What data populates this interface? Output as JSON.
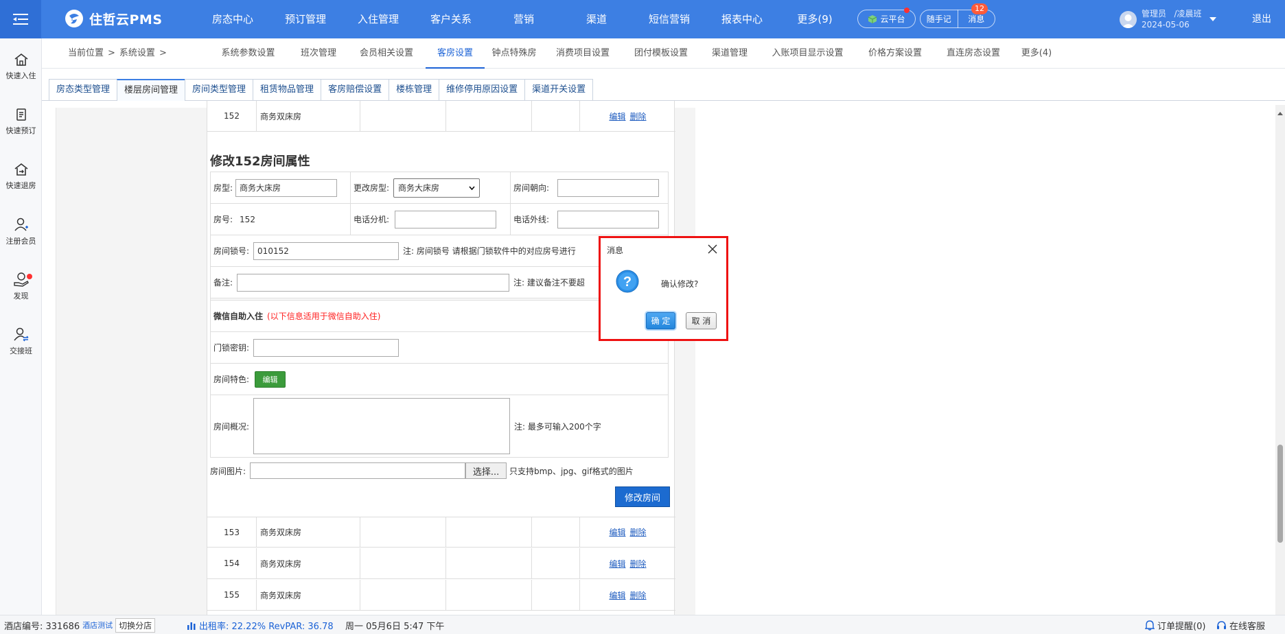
{
  "app": {
    "brand": "住哲云PMS"
  },
  "nav": [
    "房态中心",
    "预订管理",
    "入住管理",
    "客户关系",
    "营销",
    "渠道",
    "短信营销",
    "报表中心",
    "更多(9)"
  ],
  "top": {
    "cloud": "云平台",
    "notes": "随手记",
    "messages": "消息",
    "message_count": "12",
    "user_role": "管理员",
    "user_shift": "/凌晨班",
    "date": "2024-05-06",
    "logout": "退出"
  },
  "sidebar": [
    "快速入住",
    "快速预订",
    "快速退房",
    "注册会员",
    "发现",
    "交接班"
  ],
  "breadcrumb": {
    "here": "当前位置",
    "sep": ">",
    "section": "系统设置",
    "sep2": ">"
  },
  "subtabs": [
    "系统参数设置",
    "班次管理",
    "会员相关设置",
    "客房设置",
    "钟点特殊房",
    "消费项目设置",
    "团付模板设置",
    "渠道管理",
    "入账项目显示设置",
    "价格方案设置",
    "直连房态设置",
    "更多(4)"
  ],
  "tabs": [
    "房态类型管理",
    "楼层房间管理",
    "房间类型管理",
    "租赁物品管理",
    "客房赔偿设置",
    "楼栋管理",
    "维修停用原因设置",
    "渠道开关设置"
  ],
  "rows_top": [
    {
      "no": "152",
      "type": "商务双床房",
      "edit": "编辑",
      "del": "删除"
    }
  ],
  "rows_bottom": [
    {
      "no": "153",
      "type": "商务双床房",
      "edit": "编辑",
      "del": "删除"
    },
    {
      "no": "154",
      "type": "商务双床房",
      "edit": "编辑",
      "del": "删除"
    },
    {
      "no": "155",
      "type": "商务双床房",
      "edit": "编辑",
      "del": "删除"
    }
  ],
  "form": {
    "title": "修改152房间属性",
    "room_type_label": "房型:",
    "room_type_value": "商务大床房",
    "change_type_label": "更改房型:",
    "change_type_value": "商务大床房",
    "orientation_label": "房间朝向:",
    "room_no_label": "房号:",
    "room_no_value": "152",
    "ext_label": "电话分机:",
    "outline_label": "电话外线:",
    "lock_label": "房间锁号:",
    "lock_value": "010152",
    "lock_note": "注: 房间锁号 请根据门锁软件中的对应房号进行",
    "remark_label": "备注:",
    "remark_note": "注: 建议备注不要超",
    "wechat_title": "微信自助入住",
    "wechat_note": "(以下信息适用于微信自助入住)",
    "lock_key_label": "门锁密钥:",
    "feature_label": "房间特色:",
    "feature_btn": "编辑",
    "overview_label": "房间概况:",
    "overview_note": "注: 最多可输入200个字",
    "image_label": "房间图片:",
    "choose_btn": "选择...",
    "image_note": "只支持bmp、jpg、gif格式的图片",
    "submit": "修改房间"
  },
  "dialog": {
    "title": "消息",
    "message": "确认修改?",
    "ok": "确 定",
    "cancel": "取 消"
  },
  "status": {
    "hotel_no": "酒店编号: 331686",
    "hotel_tag": "酒店测试",
    "switch": "切换分店",
    "occupancy": "出租率: 22.22% RevPAR: 36.78",
    "datetime": "周一 05月6日 5:47 下午",
    "order_alert": "订单提醒(0)",
    "support": "在线客服"
  },
  "colors": {
    "primary": "#3d7fe3",
    "link": "#1d5bbf",
    "danger": "#ee1111",
    "success": "#3b9b3b"
  }
}
